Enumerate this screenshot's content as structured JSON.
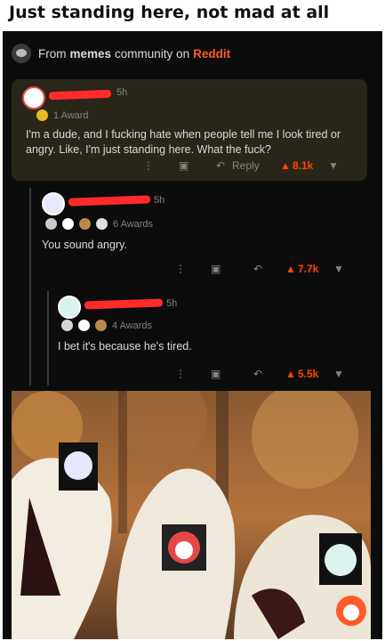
{
  "caption": "Just standing here, not mad at all",
  "header": {
    "prefix": "From",
    "community": "memes",
    "middle": "community on",
    "site": "Reddit"
  },
  "comments": [
    {
      "age": "5h",
      "awards_label": "1 Award",
      "text": "I'm a dude, and I fucking hate when people tell me I look tired or angry. Like, I'm just standing here. What the fuck?",
      "reply": "Reply",
      "score": "8.1k"
    },
    {
      "age": "5h",
      "awards_label": "6 Awards",
      "text": "You sound angry.",
      "score": "7.7k"
    },
    {
      "age": "5h",
      "awards_label": "4 Awards",
      "text": "I bet it's because he's tired.",
      "score": "5.5k"
    }
  ],
  "colors": {
    "upvote": "#ff4500",
    "redaction": "#ff2a2a",
    "highlight": "#2a2519"
  }
}
